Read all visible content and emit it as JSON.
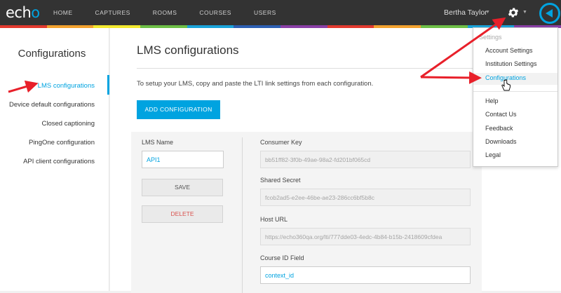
{
  "app": {
    "logo_text": "echo",
    "logo_accent": "#00a3e0"
  },
  "nav": {
    "items": [
      "HOME",
      "CAPTURES",
      "ROOMS",
      "COURSES",
      "USERS"
    ]
  },
  "user": {
    "name": "Bertha Taylor"
  },
  "colorbar": [
    "#e23a2f",
    "#f3a22f",
    "#f3e92f",
    "#6dbf46",
    "#1aa3d9",
    "#2d5fb2",
    "#8a3fa6",
    "#e23a2f",
    "#f3a22f",
    "#6dbf46",
    "#1aa3d9",
    "#8a3fa6"
  ],
  "sidebar": {
    "title": "Configurations",
    "items": [
      {
        "label": "LMS configurations",
        "active": true
      },
      {
        "label": "Device default configurations"
      },
      {
        "label": "Closed captioning"
      },
      {
        "label": "PingOne configuration"
      },
      {
        "label": "API client configurations"
      }
    ]
  },
  "main": {
    "title": "LMS configurations",
    "intro": "To setup your LMS, copy and paste the LTI link settings from each configuration.",
    "add_button": "ADD CONFIGURATION",
    "lms_name_label": "LMS Name",
    "lms_name_value": "API1",
    "save_button": "SAVE",
    "delete_button": "DELETE",
    "consumer_key_label": "Consumer Key",
    "consumer_key_value": "bb51ff82-3f0b-49ae-98a2-fd201bf065cd",
    "shared_secret_label": "Shared Secret",
    "shared_secret_value": "fcob2ad5-e2ee-46be-ae23-286cc6bf5b8c",
    "host_url_label": "Host URL",
    "host_url_value": "https://echo360qa.org/lti/777dde03-4edc-4b84-b15b-2418609cfdea",
    "course_id_label": "Course ID Field",
    "course_id_value": "context_id"
  },
  "settings_menu": {
    "header": "Settings",
    "items": [
      "Account Settings",
      "Institution Settings",
      "Configurations"
    ],
    "items2": [
      "Help",
      "Contact Us",
      "Feedback",
      "Downloads",
      "Legal"
    ]
  },
  "icons": {
    "gear": "gear-icon",
    "back": "back-circle-icon",
    "cursor": "hand-pointer-icon"
  },
  "annotation_color": "#e8202a"
}
